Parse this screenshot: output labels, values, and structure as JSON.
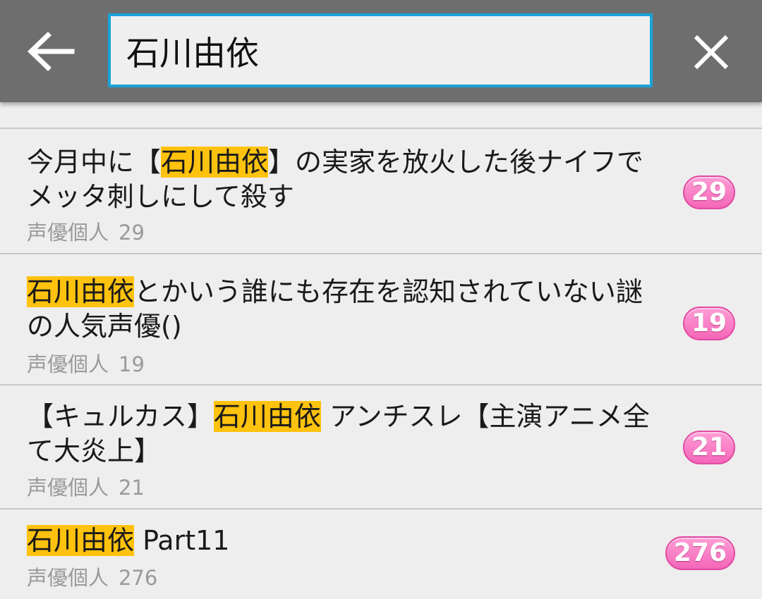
{
  "toolbar": {
    "back_icon": "arrow-left-icon",
    "search_value": "石川由依",
    "clear_icon": "close-icon"
  },
  "results": [
    {
      "title_before": "今月中に【",
      "title_highlight": "石川由依",
      "title_after": "】の実家を放火した後ナイフでメッタ刺しにして殺す",
      "category": "声優個人",
      "count": "29",
      "badge": "29"
    },
    {
      "title_before": "",
      "title_highlight": "石川由依",
      "title_after": "とかいう誰にも存在を認知されていない謎の人気声優()",
      "category": "声優個人",
      "count": "19",
      "badge": "19"
    },
    {
      "title_before": "【キュルカス】",
      "title_highlight": "石川由依",
      "title_after": " アンチスレ【主演アニメ全て大炎上】",
      "category": "声優個人",
      "count": "21",
      "badge": "21"
    },
    {
      "title_before": "",
      "title_highlight": "石川由依",
      "title_after": " Part11",
      "category": "声優個人",
      "count": "276",
      "badge": "276"
    }
  ],
  "colors": {
    "toolbar": "#6e6e6e",
    "search_border": "#1aa3d9",
    "highlight": "#ffc20e",
    "badge": "#f466b8"
  }
}
